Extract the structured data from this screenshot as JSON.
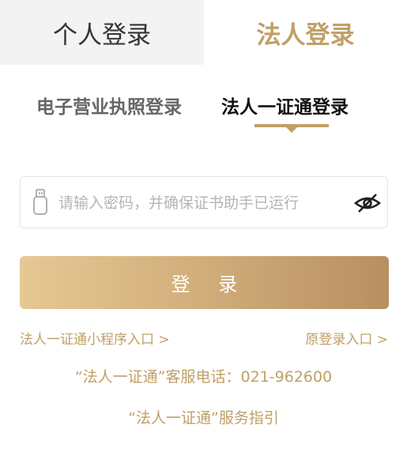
{
  "top_tabs": {
    "personal": "个人登录",
    "legal": "法人登录"
  },
  "sub_tabs": {
    "license": "电子营业执照登录",
    "cert": "法人一证通登录"
  },
  "password": {
    "placeholder": "请输入密码，并确保证书助手已运行",
    "value": ""
  },
  "login_button": "登 录",
  "links": {
    "mini_program": "法人一证通小程序入口 >",
    "original_login": "原登录入口 >"
  },
  "hotline": "“法人一证通”客服电话：021-962600",
  "guide": "“法人一证通”服务指引",
  "colors": {
    "accent": "#c0a067",
    "gradient_start": "#e6c894",
    "gradient_end": "#b88f62"
  }
}
